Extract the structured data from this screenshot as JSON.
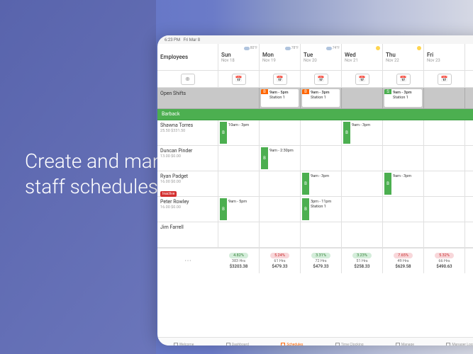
{
  "overlay": "Create and manage\nstaff schedules",
  "status": {
    "time": "6:23 PM",
    "date": "Fri Mar 8"
  },
  "header": {
    "employees_label": "Employees",
    "days": [
      {
        "name": "Sun",
        "date": "Nov 18",
        "temp": "80°F",
        "icon": "cloud"
      },
      {
        "name": "Mon",
        "date": "Nov 19",
        "temp": "78°F",
        "icon": "cloud"
      },
      {
        "name": "Tue",
        "date": "Nov 20",
        "temp": "74°F",
        "icon": "cloud"
      },
      {
        "name": "Wed",
        "date": "Nov 21",
        "temp": "",
        "icon": "sun"
      },
      {
        "name": "Thu",
        "date": "Nov 22",
        "temp": "",
        "icon": "sun"
      },
      {
        "name": "Fri",
        "date": "Nov 23",
        "temp": "",
        "icon": ""
      }
    ]
  },
  "open_shifts": {
    "label": "Open Shifts",
    "shifts": [
      null,
      {
        "marker": "B",
        "color": "orange",
        "time": "9am - 5pm",
        "loc": "Station 1"
      },
      {
        "marker": "B",
        "color": "orange",
        "time": "9am - 3pm",
        "loc": "Station 1"
      },
      null,
      {
        "marker": "S",
        "color": "green",
        "time": "9am - 3pm",
        "loc": "Station 1"
      },
      null
    ]
  },
  "group": "Barback",
  "employees": [
    {
      "name": "Shawna Torres",
      "meta": "25.50   $331.50",
      "inactive": false,
      "shifts": [
        {
          "marker": "B",
          "time": "10am - 3pm"
        },
        null,
        null,
        {
          "marker": "B",
          "time": "9am - 3pm"
        },
        null,
        null
      ]
    },
    {
      "name": "Duncan Pinder",
      "meta": "13.00   $0.00",
      "inactive": false,
      "shifts": [
        null,
        {
          "marker": "B",
          "time": "9am - 2:30pm"
        },
        null,
        null,
        null,
        null
      ]
    },
    {
      "name": "Ryan Padget",
      "meta": "16.00   $0.00",
      "inactive": true,
      "shifts": [
        null,
        null,
        {
          "marker": "B",
          "time": "9am - 3pm"
        },
        null,
        {
          "marker": "B",
          "time": "9am - 3pm"
        },
        null
      ]
    },
    {
      "name": "Peter Rowley",
      "meta": "16.00   $0.00",
      "inactive": false,
      "shifts": [
        {
          "marker": "B",
          "time": "9am - 5pm"
        },
        null,
        {
          "marker": "B",
          "time": "3pm - 11pm",
          "loc": "Station 1"
        },
        null,
        null,
        null
      ]
    },
    {
      "name": "Jim Farrell",
      "meta": "",
      "inactive": false,
      "shifts": [
        null,
        null,
        null,
        null,
        null,
        null
      ]
    }
  ],
  "inactive_label": "Inactive",
  "summary": [
    {
      "pct": "4.82%",
      "cls": "green",
      "hrs": "383 Hrs",
      "amt": "$3203.38"
    },
    {
      "pct": "5.24%",
      "cls": "red",
      "hrs": "61 Hrs",
      "amt": "$479.33"
    },
    {
      "pct": "3.31%",
      "cls": "green",
      "hrs": "72 Hrs",
      "amt": "$479.33"
    },
    {
      "pct": "3.23%",
      "cls": "green",
      "hrs": "51 Hrs",
      "amt": "$258.33"
    },
    {
      "pct": "7.65%",
      "cls": "red",
      "hrs": "49 Hrs",
      "amt": "$629.58"
    },
    {
      "pct": "5.32%",
      "cls": "red",
      "hrs": "66 Hrs",
      "amt": "$490.63"
    }
  ],
  "nav": [
    {
      "label": "Welcome",
      "active": false
    },
    {
      "label": "Dashboard",
      "active": false
    },
    {
      "label": "Schedules",
      "active": true
    },
    {
      "label": "Time Clocking",
      "active": false
    },
    {
      "label": "Manage",
      "active": false
    },
    {
      "label": "Manager Log Book",
      "active": false
    }
  ]
}
